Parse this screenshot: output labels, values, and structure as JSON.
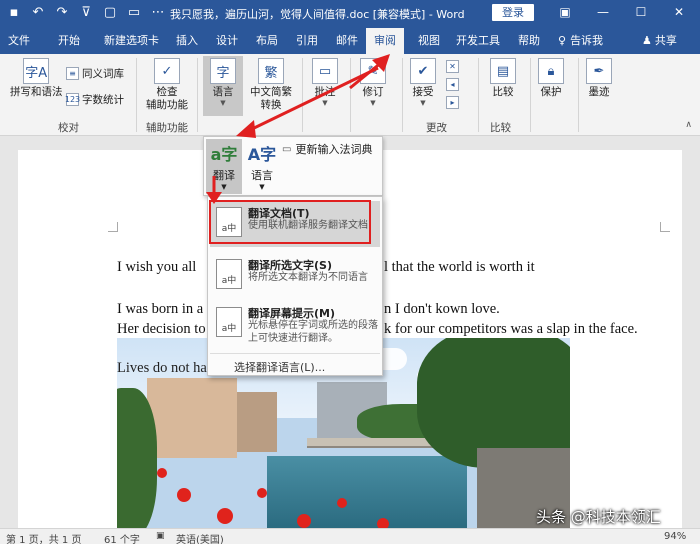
{
  "titlebar": {
    "title": "我只愿我，遍历山河，觉得人间值得.doc [兼容模式] - Word",
    "login": "登录",
    "qat_icons": [
      "save-icon",
      "undo-icon",
      "redo-icon",
      "customize-icon",
      "new-doc-icon",
      "open-icon",
      "more-icon"
    ]
  },
  "tabs": [
    "文件",
    "开始",
    "新建选项卡",
    "插入",
    "设计",
    "布局",
    "引用",
    "邮件",
    "审阅",
    "视图",
    "开发工具",
    "帮助"
  ],
  "tellme": "告诉我",
  "share": "共享",
  "ribbon": {
    "spelling": "拼写和语法",
    "thesaurus": "同义词库",
    "wordcount": "字数统计",
    "proofing_group": "校对",
    "check_accessibility": [
      "检查",
      "辅助功能"
    ],
    "accessibility_group": "辅助功能",
    "language": "语言",
    "chinese_convert": [
      "中文简繁",
      "转换"
    ],
    "comments": "批注",
    "track": "修订",
    "accept": "接受",
    "changes_group": "更改",
    "compare": "比较",
    "compare_group": "比较",
    "protect": "保护",
    "ink": "墨迹"
  },
  "lang_panel": {
    "translate": "翻译",
    "language": "语言",
    "update_ime": "更新输入法词典"
  },
  "menu": {
    "items": [
      {
        "title": "翻译文档(T)",
        "desc": "使用联机翻译服务翻译文档"
      },
      {
        "title": "翻译所选文字(S)",
        "desc": "将所选文本翻译为不同语言"
      },
      {
        "title": "翻译屏幕提示(M)",
        "desc": "光标悬停在字词或所选的段落上可快速进行翻译。"
      }
    ],
    "bottom": "选择翻译语言(L)..."
  },
  "document": {
    "line1_left": "I wish you all",
    "line1_right": "l that the world is worth it",
    "line2_left": "I was born in a",
    "line2_right": "n I don't kown love.",
    "line3_left": "Her decision to",
    "line3_right": "k for our competitors was a slap in the face.",
    "line4": "Lives do not ha"
  },
  "statusbar": {
    "page": "第 1 页，共 1 页",
    "words": "61 个字",
    "language": "英语(美国)",
    "zoom": "94%"
  },
  "watermark": "头条 @科技本领汇"
}
